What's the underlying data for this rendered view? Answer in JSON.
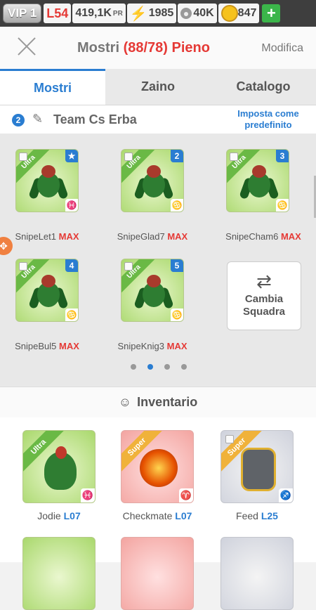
{
  "topbar": {
    "vip": "VIP 1",
    "level": "L54",
    "power": "419,1K",
    "power_unit": "PR",
    "energy": "1985",
    "food": "40K",
    "gold": "847",
    "plus": "+"
  },
  "header": {
    "title": "Mostri",
    "count": "(88/78) Pieno",
    "edit": "Modifica"
  },
  "tabs": [
    "Mostri",
    "Zaino",
    "Catalogo"
  ],
  "team": {
    "number": "2",
    "name": "Team Cs Erba",
    "set_default": "Imposta come predefinito",
    "members": [
      {
        "name": "SnipeLet1",
        "level": "MAX",
        "badge": "★",
        "rarity": "Ultra",
        "element": "♓"
      },
      {
        "name": "SnipeGlad7",
        "level": "MAX",
        "badge": "2",
        "rarity": "Ultra",
        "element": "♋"
      },
      {
        "name": "SnipeCham6",
        "level": "MAX",
        "badge": "3",
        "rarity": "Ultra",
        "element": "♋"
      },
      {
        "name": "SnipeBul5",
        "level": "MAX",
        "badge": "4",
        "rarity": "Ultra",
        "element": "♋"
      },
      {
        "name": "SnipeKnig3",
        "level": "MAX",
        "badge": "5",
        "rarity": "Ultra",
        "element": "♋"
      }
    ],
    "swap_label": "Cambia Squadra"
  },
  "inventory": {
    "title": "Inventario",
    "items": [
      {
        "name": "Jodie",
        "level": "L07",
        "rarity": "Ultra",
        "element": "♓"
      },
      {
        "name": "Checkmate",
        "level": "L07",
        "rarity": "Super",
        "element": "♈"
      },
      {
        "name": "Feed",
        "level": "L25",
        "rarity": "Super",
        "element": "♐"
      }
    ]
  },
  "colors": {
    "accent": "#2a7dd1",
    "warn": "#e53935"
  }
}
